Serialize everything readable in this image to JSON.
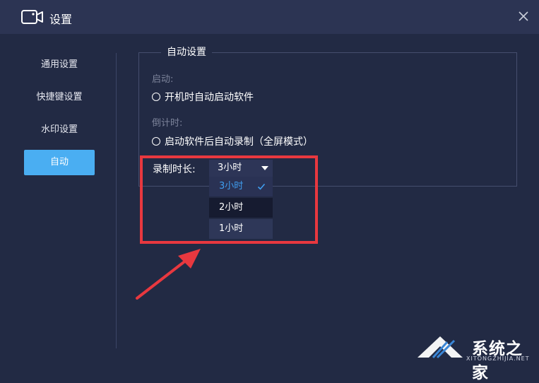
{
  "window": {
    "title": "设置",
    "close_glyph": "✕"
  },
  "sidebar": {
    "items": [
      {
        "label": "通用设置",
        "active": false
      },
      {
        "label": "快捷键设置",
        "active": false
      },
      {
        "label": "水印设置",
        "active": false
      },
      {
        "label": "自动",
        "active": true
      }
    ]
  },
  "auto": {
    "group_title": "自动设置",
    "startup": {
      "label": "启动:",
      "option": "开机时自动启动软件"
    },
    "countdown": {
      "label": "倒计时:",
      "option": "启动软件后自动录制（全屏模式）"
    },
    "duration": {
      "label": "录制时长:",
      "selected": "3小时",
      "options": [
        {
          "label": "3小时",
          "selected": true
        },
        {
          "label": "2小时",
          "selected": false
        },
        {
          "label": "1小时",
          "selected": false
        }
      ]
    }
  },
  "watermark": {
    "text": "系统之家",
    "sub": "XITONGZHIJIA.NET"
  },
  "colors": {
    "background": "#222a44",
    "titlebar": "#2c3453",
    "accent": "#4aaef2",
    "highlight_red": "#e8383f"
  }
}
